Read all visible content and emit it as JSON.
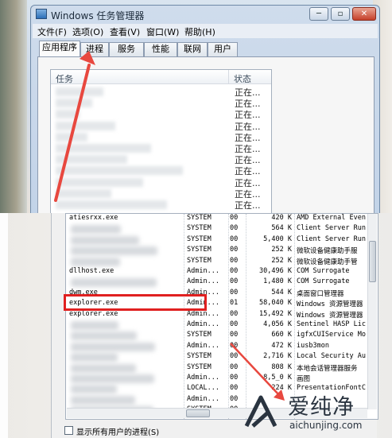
{
  "window": {
    "title": "Windows 任务管理器",
    "controls": {
      "minimize": "─",
      "maximize": "▫",
      "close": "✕"
    }
  },
  "menu": [
    "文件(F)",
    "选项(O)",
    "查看(V)",
    "窗口(W)",
    "帮助(H)"
  ],
  "tabs": [
    "应用程序",
    "进程",
    "服务",
    "性能",
    "联网",
    "用户"
  ],
  "active_tab": "应用程序",
  "task_list": {
    "columns": {
      "task": "任务",
      "status": "状态"
    },
    "status_values": [
      "正在...",
      "正在...",
      "正在...",
      "正在...",
      "正在...",
      "正在...",
      "正在...",
      "正在...",
      "正在...",
      "正在...",
      "正在..."
    ]
  },
  "process_list": {
    "rows": [
      {
        "name": "atiesrxx.exe",
        "user": "SYSTEM",
        "cpu": "00",
        "mem": "420 K",
        "desc": "AMD External Even"
      },
      {
        "name": "",
        "user": "SYSTEM",
        "cpu": "00",
        "mem": "564 K",
        "desc": "Client Server Run"
      },
      {
        "name": "",
        "user": "SYSTEM",
        "cpu": "00",
        "mem": "5,400 K",
        "desc": "Client Server Run"
      },
      {
        "name": "",
        "user": "SYSTEM",
        "cpu": "00",
        "mem": "252 K",
        "desc": "微软设备健康助手服"
      },
      {
        "name": "",
        "user": "SYSTEM",
        "cpu": "00",
        "mem": "252 K",
        "desc": "微软设备健康助手管"
      },
      {
        "name": "dllhost.exe",
        "user": "Admin...",
        "cpu": "00",
        "mem": "30,496 K",
        "desc": "COM Surrogate"
      },
      {
        "name": "",
        "user": "Admin...",
        "cpu": "00",
        "mem": "1,480 K",
        "desc": "COM Surrogate"
      },
      {
        "name": "dwm.exe",
        "user": "Admin...",
        "cpu": "00",
        "mem": "544 K",
        "desc": "桌面窗口管理器"
      },
      {
        "name": "explorer.exe",
        "user": "Admin...",
        "cpu": "01",
        "mem": "58,040 K",
        "desc": "Windows 资源管理器"
      },
      {
        "name": "explorer.exe",
        "user": "Admin...",
        "cpu": "00",
        "mem": "15,492 K",
        "desc": "Windows 资源管理器"
      },
      {
        "name": "",
        "user": "Admin...",
        "cpu": "00",
        "mem": "4,056 K",
        "desc": "Sentinel HASP Lic"
      },
      {
        "name": "",
        "user": "SYSTEM",
        "cpu": "00",
        "mem": "660 K",
        "desc": "igfxCUIService Mo"
      },
      {
        "name": "",
        "user": "Admin...",
        "cpu": "00",
        "mem": "472 K",
        "desc": "iusb3mon"
      },
      {
        "name": "",
        "user": "SYSTEM",
        "cpu": "00",
        "mem": "2,716 K",
        "desc": "Local Security Au"
      },
      {
        "name": "",
        "user": "SYSTEM",
        "cpu": "00",
        "mem": "808 K",
        "desc": "本地会话管理器服务"
      },
      {
        "name": "",
        "user": "Admin...",
        "cpu": "00",
        "mem": "8,5_0 K",
        "desc": "画图"
      },
      {
        "name": "",
        "user": "LOCAL...",
        "cpu": "00",
        "mem": "224 K",
        "desc": "PresentationFontC"
      },
      {
        "name": "",
        "user": "Admin...",
        "cpu": "00",
        "mem": "",
        "desc": ""
      },
      {
        "name": "",
        "user": "SYSTEM",
        "cpu": "00",
        "mem": "",
        "desc": ""
      }
    ],
    "show_all_label": "显示所有用户的进程(S)"
  },
  "watermark": {
    "title": "爱纯净",
    "url": "aichunjing.com"
  },
  "colors": {
    "highlight": "#e02020",
    "arrow": "#e8483f"
  }
}
